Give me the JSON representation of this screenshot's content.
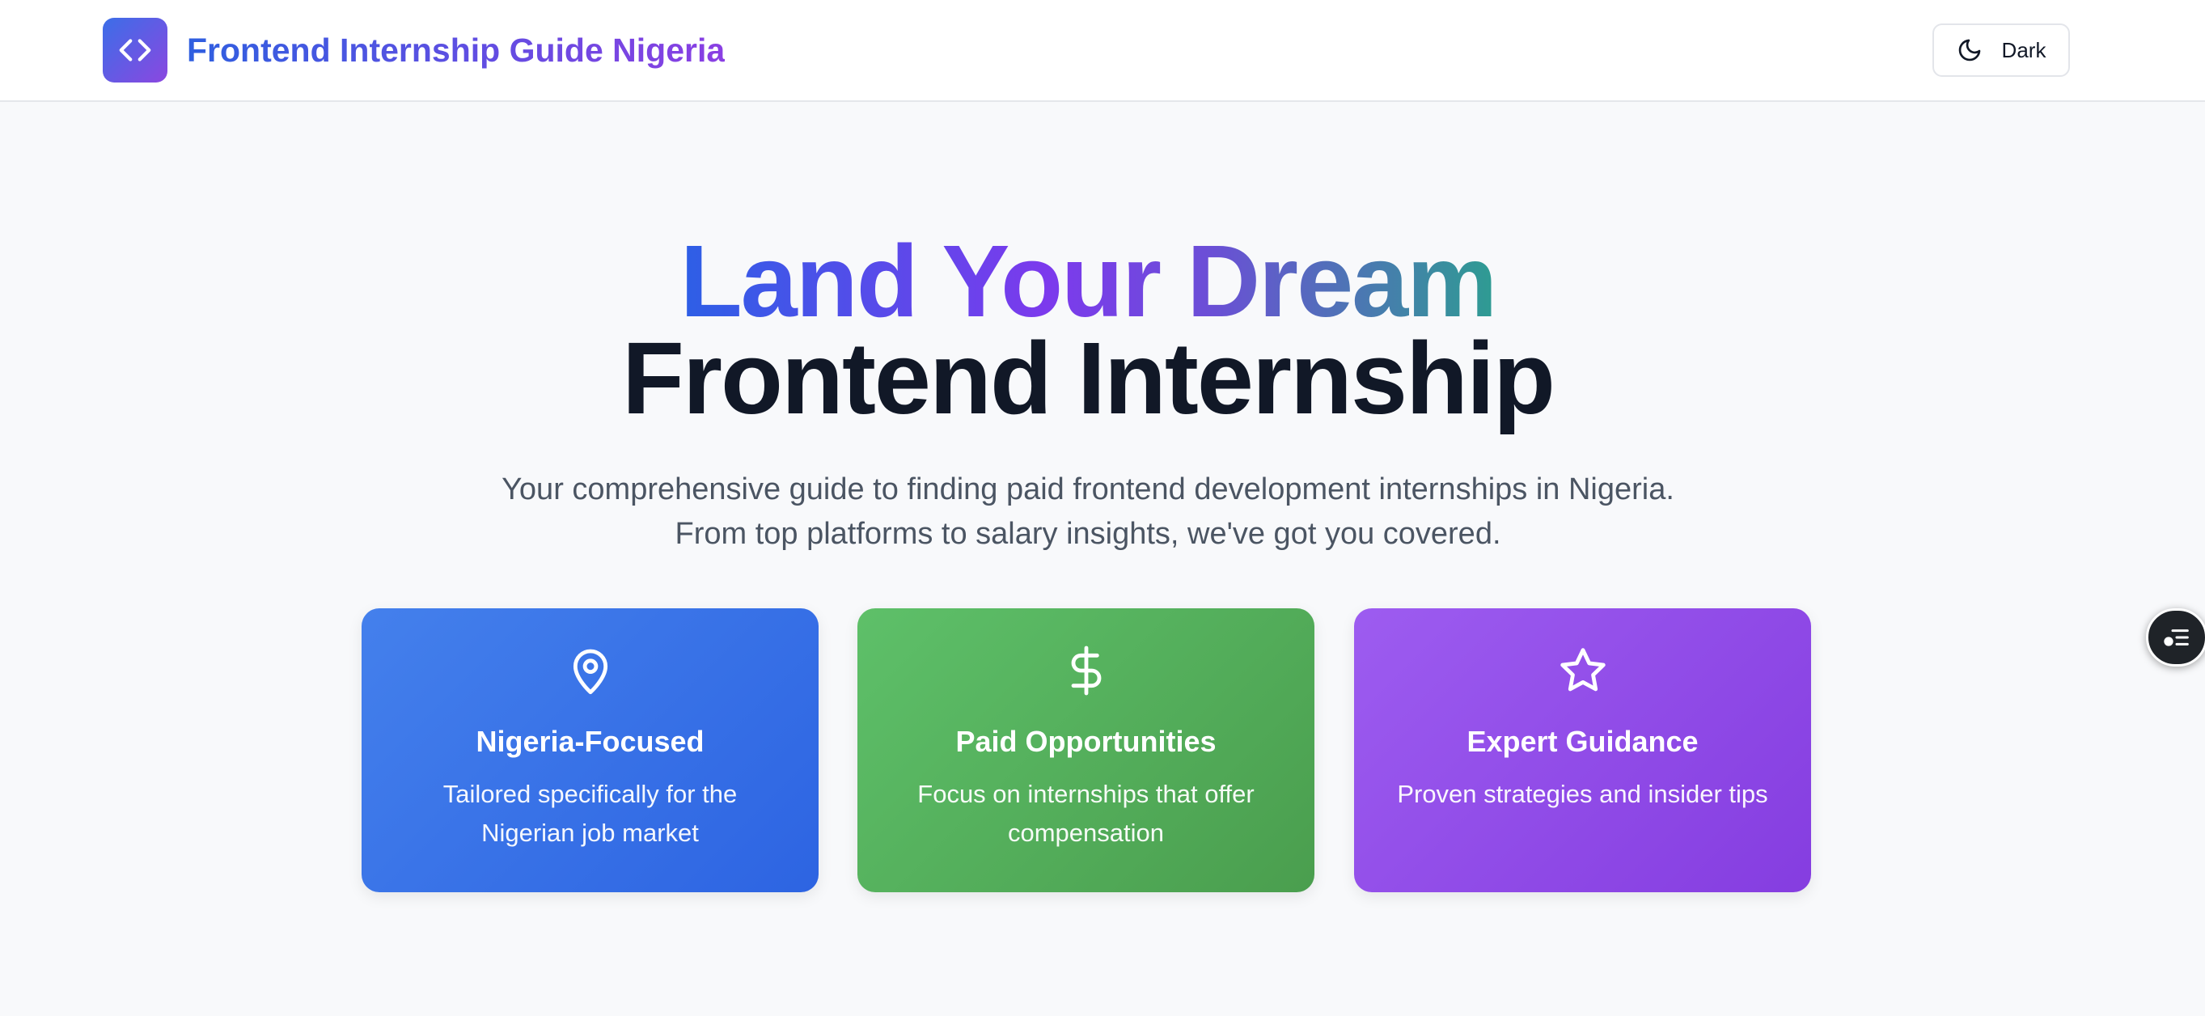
{
  "header": {
    "brand": "Frontend Internship Guide Nigeria",
    "logo_icon": "code-icon",
    "theme_toggle": {
      "label": "Dark",
      "icon": "moon-icon"
    }
  },
  "hero": {
    "title_line1": "Land Your Dream",
    "title_line2": "Frontend Internship",
    "subtitle_line1": "Your comprehensive guide to finding paid frontend development internships in Nigeria.",
    "subtitle_line2": "From top platforms to salary insights, we've got you covered."
  },
  "features": [
    {
      "icon": "map-pin-icon",
      "title": "Nigeria-Focused",
      "description": "Tailored specifically for the Nigerian job market",
      "color": "#3a72e8"
    },
    {
      "icon": "dollar-icon",
      "title": "Paid Opportunities",
      "description": "Focus on internships that offer compensation",
      "color": "#53ae5b"
    },
    {
      "icon": "star-icon",
      "title": "Expert Guidance",
      "description": "Proven strategies and insider tips",
      "color": "#924de8"
    }
  ],
  "floating_button": {
    "icon": "list-icon"
  },
  "colors": {
    "brand_gradient_start": "#2f5fe0",
    "brand_gradient_end": "#8a3fe3",
    "heading_dark": "#111827",
    "body_text": "#4b5563",
    "background": "#f8f9fb"
  }
}
